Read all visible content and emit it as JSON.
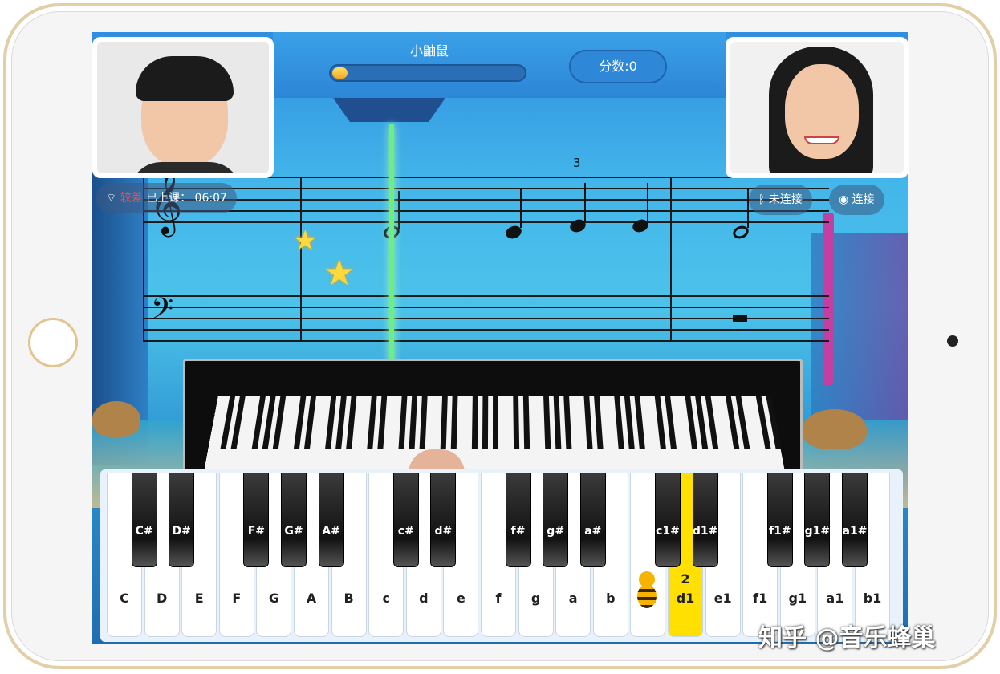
{
  "game": {
    "level_title": "小鼬鼠",
    "progress": 0.08,
    "score_label": "分数:0",
    "beat_marker": "3"
  },
  "status": {
    "signal_label": "较差",
    "elapsed_label": "已上课：",
    "elapsed_time": "06:07",
    "bluetooth_label": "未连接",
    "camera_label": "连接"
  },
  "piano": {
    "white_keys": [
      {
        "label": "C"
      },
      {
        "label": "D"
      },
      {
        "label": "E"
      },
      {
        "label": "F"
      },
      {
        "label": "G"
      },
      {
        "label": "A"
      },
      {
        "label": "B"
      },
      {
        "label": "c"
      },
      {
        "label": "d"
      },
      {
        "label": "e"
      },
      {
        "label": "f"
      },
      {
        "label": "g"
      },
      {
        "label": "a"
      },
      {
        "label": "b"
      },
      {
        "label": "c1"
      },
      {
        "label": "d1",
        "finger": "2",
        "active": true
      },
      {
        "label": "e1"
      },
      {
        "label": "f1"
      },
      {
        "label": "g1"
      },
      {
        "label": "a1"
      },
      {
        "label": "b1"
      }
    ],
    "black_keys": [
      "C#",
      "D#",
      "F#",
      "G#",
      "A#",
      "c#",
      "d#",
      "f#",
      "g#",
      "a#",
      "c1#",
      "d1#",
      "f1#",
      "g1#",
      "a1#"
    ]
  },
  "watermark": "知乎 @音乐蜂巢",
  "icons": [
    "wifi-icon",
    "bluetooth-icon",
    "camera-icon",
    "treble-clef-icon",
    "bass-clef-icon",
    "star-icon",
    "bee-mascot-icon"
  ],
  "colors": {
    "accent": "#2f87d8",
    "playhead": "#6cf07b",
    "active_key": "#ffe000",
    "warning": "#ff4a4a"
  }
}
